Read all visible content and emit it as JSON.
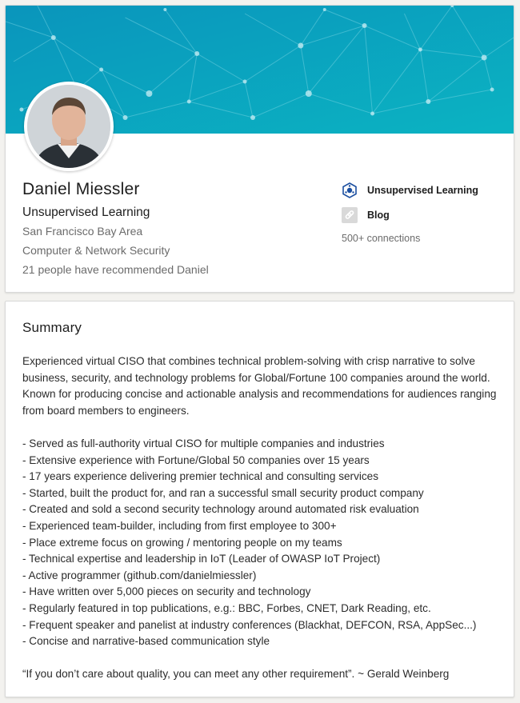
{
  "profile": {
    "name": "Daniel Miessler",
    "headline": "Unsupervised Learning",
    "location": "San Francisco Bay Area",
    "industry": "Computer & Network Security",
    "recommendations": "21 people have recommended Daniel",
    "company": "Unsupervised Learning",
    "blog_label": "Blog",
    "connections": "500+ connections",
    "colors": {
      "banner_start": "#0a9bbf",
      "banner_end": "#0bb0c0",
      "company_icon": "#1c4fa0"
    }
  },
  "summary": {
    "title": "Summary",
    "intro": "Experienced virtual CISO that combines technical problem-solving with crisp narrative to solve business, security, and technology problems for Global/Fortune 100 companies around the world. Known for producing concise and actionable analysis and recommendations for audiences ranging from board members to engineers.",
    "bullets": [
      "- Served as full-authority virtual CISO for multiple companies and industries",
      "- Extensive experience with Fortune/Global 50 companies over 15 years",
      "- 17 years experience delivering premier technical and consulting services",
      "- Started, built the product for, and ran a successful small security product company",
      "- Created and sold a second security technology around automated risk evaluation",
      "- Experienced team-builder, including from first employee to 300+",
      "- Place extreme focus on growing / mentoring people on my teams",
      "- Technical expertise and leadership in IoT (Leader of OWASP IoT Project)",
      "- Active programmer (github.com/danielmiessler)",
      "- Have written over 5,000 pieces on security and technology",
      "- Regularly featured in top publications, e.g.: BBC, Forbes, CNET, Dark Reading, etc.",
      "- Frequent speaker and panelist at industry conferences (Blackhat, DEFCON, RSA, AppSec...)",
      "- Concise and narrative-based communication style"
    ],
    "quote": "“If you don’t care about quality, you can meet any other requirement”. ~ Gerald Weinberg"
  }
}
